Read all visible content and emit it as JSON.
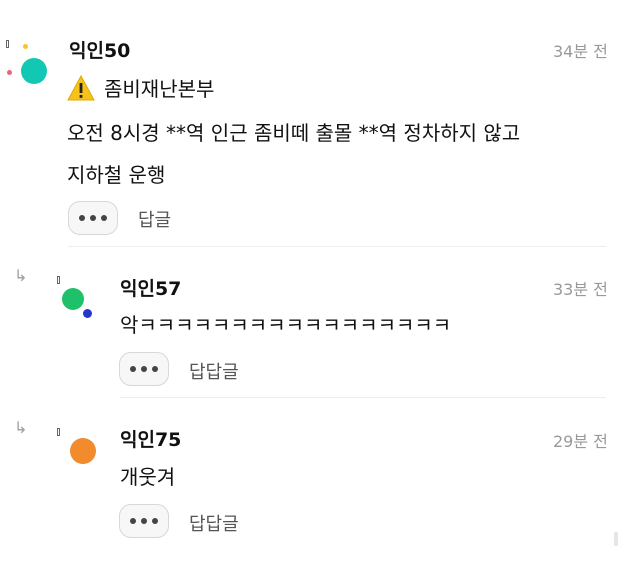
{
  "comments": [
    {
      "author": "익인50",
      "time": "34분 전",
      "badge_icon": "warning-icon",
      "title": "좀비재난본부",
      "line1": "오전 8시경 **역 인근 좀비떼 출몰 **역 정차하지 않고",
      "line2": "지하철 운행",
      "reply_label": "답글",
      "avatar_colors": [
        "#12c7b3",
        "#f4c430",
        "#e8657a"
      ]
    },
    {
      "author": "익인57",
      "time": "33분 전",
      "body": "악ㅋㅋㅋㅋㅋㅋㅋㅋㅋㅋㅋㅋㅋㅋㅋㅋㅋ",
      "reply_label": "답답글",
      "avatar_colors": [
        "#1fc06a",
        "#2436d0"
      ]
    },
    {
      "author": "익인75",
      "time": "29분 전",
      "body": "개웃겨",
      "reply_label": "답답글",
      "avatar_colors": [
        "#f28a2e"
      ]
    }
  ]
}
